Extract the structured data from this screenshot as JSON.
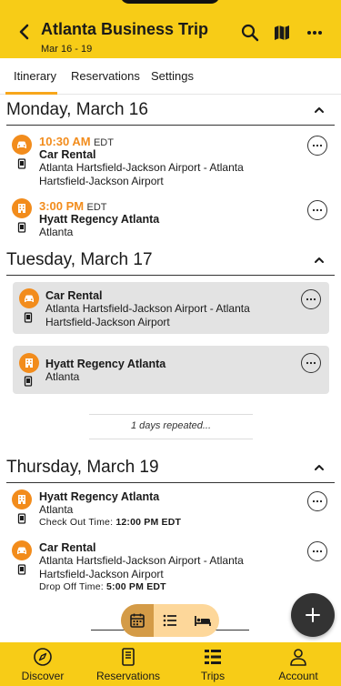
{
  "header": {
    "title": "Atlanta Business Trip",
    "subtitle": "Mar 16 - 19",
    "background": "#f7cc17",
    "icons": [
      "back-arrow-icon",
      "search-icon",
      "map-icon",
      "more-horizontal-icon"
    ]
  },
  "tabs": [
    {
      "label": "Itinerary",
      "active": true
    },
    {
      "label": "Reservations"
    },
    {
      "label": "Settings"
    }
  ],
  "days": [
    {
      "title": "Monday, March 16",
      "items": [
        {
          "time": "10:30 AM",
          "tz": "EDT",
          "title": "Car Rental",
          "subtitle": "Atlanta Hartsfield-Jackson Airport - Atlanta Hartsfield-Jackson Airport",
          "icon": "car-icon"
        },
        {
          "time": "3:00 PM",
          "tz": "EDT",
          "title": "Hyatt Regency Atlanta",
          "subtitle": "Atlanta",
          "icon": "hotel-icon"
        }
      ]
    },
    {
      "title": "Tuesday, March 17",
      "items": [
        {
          "title": "Car Rental",
          "subtitle": "Atlanta Hartsfield-Jackson Airport - Atlanta Hartsfield-Jackson Airport",
          "icon": "car-icon"
        },
        {
          "title": "Hyatt Regency Atlanta",
          "subtitle": "Atlanta",
          "icon": "hotel-icon"
        }
      ]
    },
    {
      "title": "Thursday, March 19",
      "items": [
        {
          "title": "Hyatt Regency Atlanta",
          "subtitle": "Atlanta",
          "detail_label": "Check Out Time: ",
          "detail_value": "12:00 PM EDT",
          "icon": "hotel-icon"
        },
        {
          "title": "Car Rental",
          "subtitle": "Atlanta Hartsfield-Jackson Airport - Atlanta Hartsfield-Jackson Airport",
          "detail_label": "Drop Off Time: ",
          "detail_value": "5:00 PM EDT",
          "icon": "car-icon"
        }
      ]
    }
  ],
  "repeated_text": "1 days repeated...",
  "view_toggle": {
    "options": [
      "calendar-icon",
      "list-icon",
      "bed-icon"
    ],
    "selected": "calendar-icon"
  },
  "fab_label": "+",
  "bottom_nav": [
    {
      "label": "Discover",
      "icon": "compass-icon"
    },
    {
      "label": "Reservations",
      "icon": "reservations-icon"
    },
    {
      "label": "Trips",
      "icon": "trips-icon",
      "active": true
    },
    {
      "label": "Account",
      "icon": "account-icon"
    }
  ],
  "colors": {
    "accent_orange": "#f28c1c",
    "brand_yellow": "#f7cc17",
    "card_gray": "#e3e3e3"
  }
}
